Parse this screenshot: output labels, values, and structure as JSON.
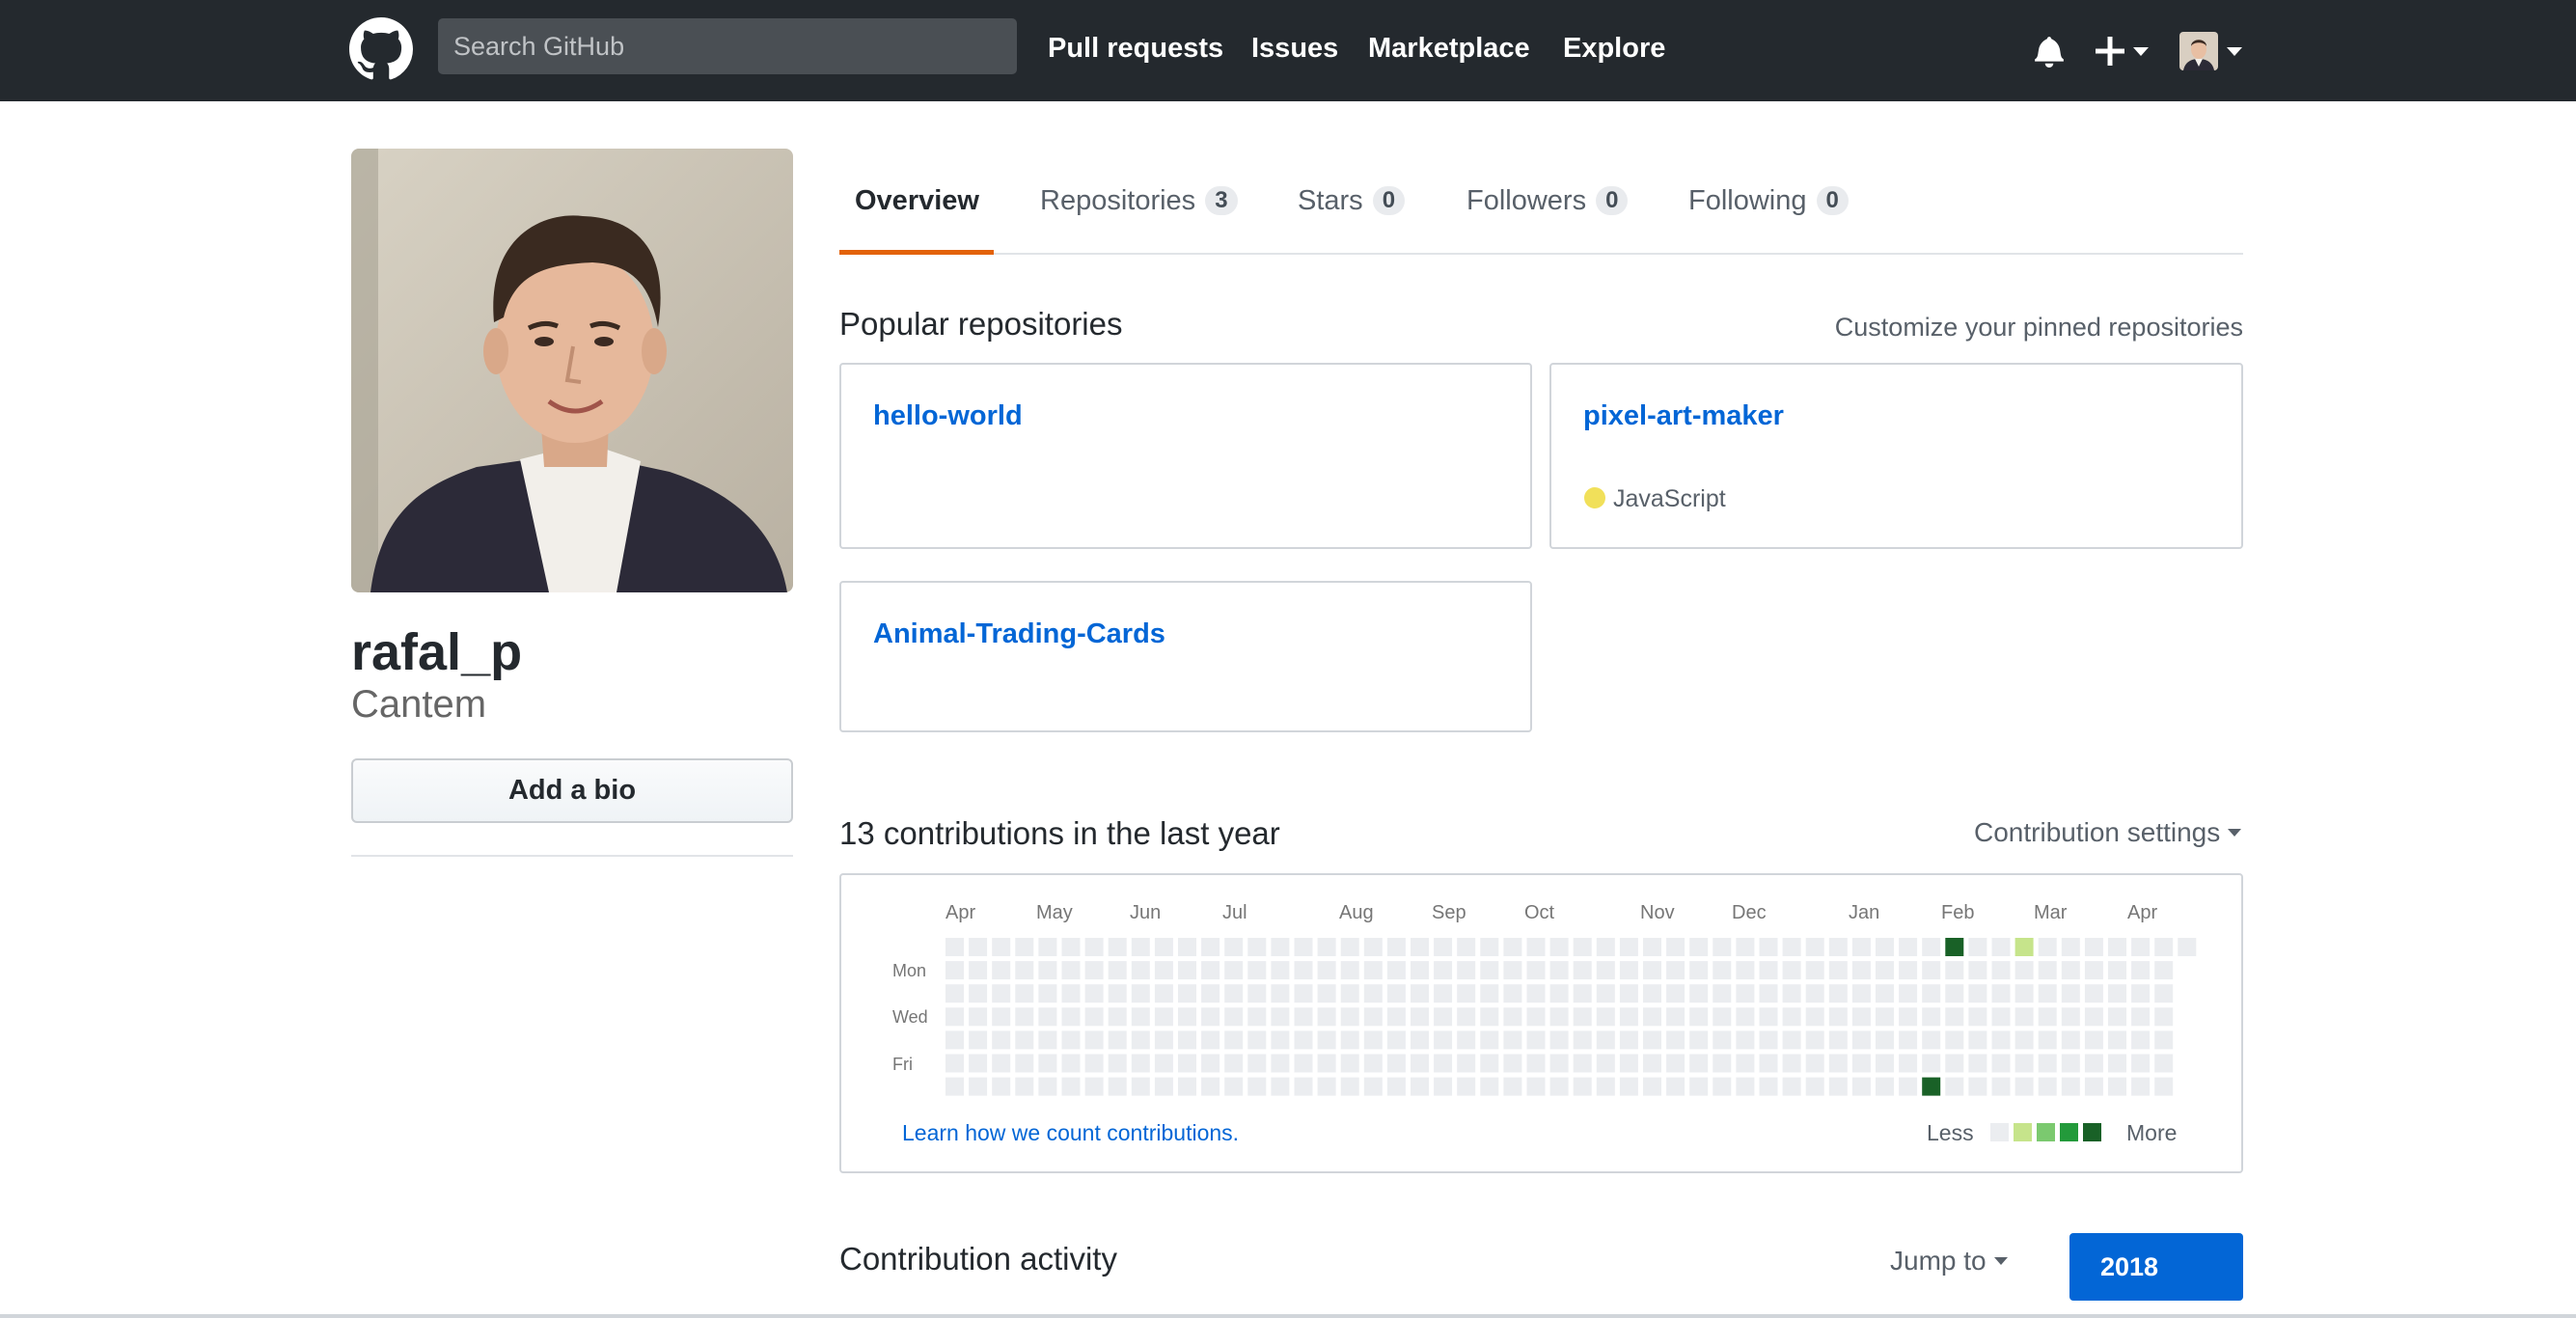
{
  "header": {
    "search_placeholder": "Search GitHub",
    "nav": [
      "Pull requests",
      "Issues",
      "Marketplace",
      "Explore"
    ],
    "icons": [
      "github-logo-icon",
      "bell-icon",
      "plus-icon",
      "avatar"
    ]
  },
  "profile": {
    "username": "rafal_p",
    "name": "Cantem",
    "bio_button": "Add a bio"
  },
  "tabs": [
    {
      "label": "Overview",
      "active": true
    },
    {
      "label": "Repositories",
      "count": "3"
    },
    {
      "label": "Stars",
      "count": "0"
    },
    {
      "label": "Followers",
      "count": "0"
    },
    {
      "label": "Following",
      "count": "0"
    }
  ],
  "pinned": {
    "title": "Popular repositories",
    "customize": "Customize your pinned repositories",
    "repos": [
      {
        "name": "hello-world"
      },
      {
        "name": "pixel-art-maker",
        "language": "JavaScript",
        "language_color": "#f1e05a"
      },
      {
        "name": "Animal-Trading-Cards"
      }
    ]
  },
  "contributions": {
    "title": "13 contributions in the last year",
    "settings": "Contribution settings",
    "months": [
      "Apr",
      "May",
      "Jun",
      "Jul",
      "Aug",
      "Sep",
      "Oct",
      "Nov",
      "Dec",
      "Jan",
      "Feb",
      "Mar",
      "Apr"
    ],
    "days": [
      "Mon",
      "Wed",
      "Fri"
    ],
    "learn_link": "Learn how we count contributions.",
    "legend_less": "Less",
    "legend_more": "More",
    "level_colors": [
      "#ebedf0",
      "#c6e48b",
      "#7bc96f",
      "#239a3b",
      "#196127"
    ],
    "active_cells": [
      {
        "week": 43,
        "day": 0,
        "level": 4
      },
      {
        "week": 46,
        "day": 0,
        "level": 1
      },
      {
        "week": 42,
        "day": 6,
        "level": 4
      }
    ]
  },
  "activity": {
    "title": "Contribution activity",
    "jump_to": "Jump to",
    "year": "2018"
  }
}
